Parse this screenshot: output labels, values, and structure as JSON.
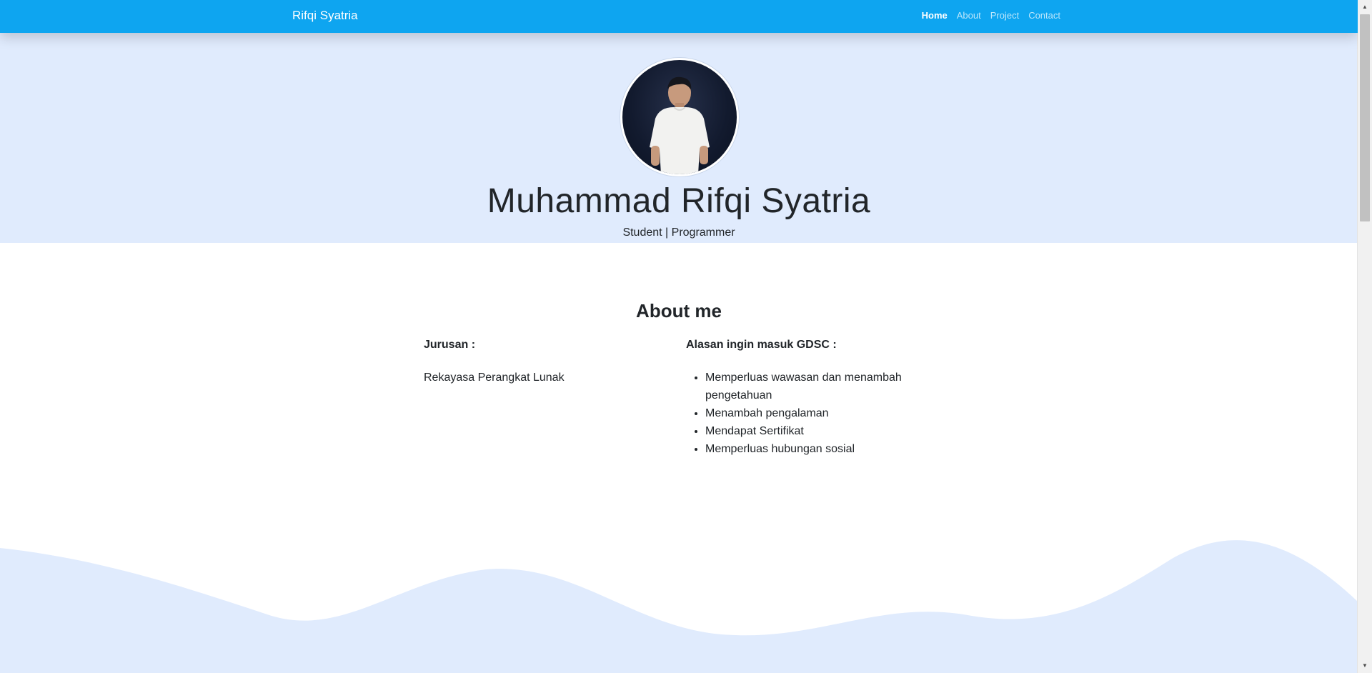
{
  "navbar": {
    "brand": "Rifqi Syatria",
    "links": [
      {
        "label": "Home",
        "active": true
      },
      {
        "label": "About",
        "active": false
      },
      {
        "label": "Project",
        "active": false
      },
      {
        "label": "Contact",
        "active": false
      }
    ]
  },
  "hero": {
    "name": "Muhammad Rifqi Syatria",
    "subtitle": "Student | Programmer"
  },
  "about": {
    "title": "About me",
    "left": {
      "heading": "Jurusan :",
      "text": "Rekayasa Perangkat Lunak"
    },
    "right": {
      "heading": "Alasan ingin masuk GDSC :",
      "items": [
        "Memperluas wawasan dan menambah pengetahuan",
        "Menambah pengalaman",
        "Mendapat Sertifikat",
        "Memperluas hubungan sosial"
      ]
    }
  },
  "colors": {
    "navbar": "#0ea5f0",
    "hero_bg": "#e0ebfd",
    "wave": "#e0ebfd",
    "text": "#212529"
  }
}
